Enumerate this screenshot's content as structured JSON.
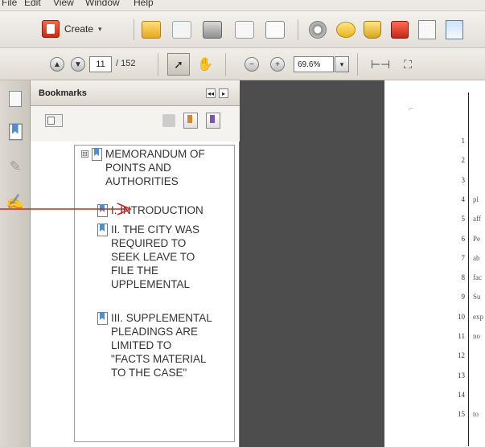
{
  "menu": [
    "File",
    "Edit",
    "View",
    "Window",
    "Help"
  ],
  "toolbar": {
    "create_label": "Create",
    "create_chevron": "▾"
  },
  "nav": {
    "page_number": "11",
    "page_total": "/ 152",
    "zoom_value": "69.6%",
    "zoom_chevron": "▾"
  },
  "bookmarks_panel": {
    "title": "Bookmarks",
    "collapse_btn": "◂◂",
    "options_btn": "▸",
    "expander_symbol": "⊟"
  },
  "bookmarks": [
    {
      "label": "MEMORANDUM OF\nPOINTS AND\nAUTHORITIES",
      "level": 0,
      "expandable": true
    },
    {
      "label": "I. INTRODUCTION",
      "level": 1,
      "expandable": false
    },
    {
      "label": "II. THE CITY WAS\nREQUIRED TO\nSEEK LEAVE TO\nFILE THE\nUPPLEMENTAL",
      "level": 1,
      "expandable": false
    },
    {
      "label": "III. SUPPLEMENTAL\nPLEADINGS ARE\nLIMITED TO\n\"FACTS MATERIAL\nTO THE CASE\"",
      "level": 1,
      "expandable": false
    }
  ],
  "document": {
    "line_numbers": [
      "1",
      "2",
      "3",
      "4",
      "5",
      "6",
      "7",
      "8",
      "9",
      "10",
      "11",
      "12",
      "13",
      "14",
      "15"
    ],
    "line_text": [
      "",
      "",
      "",
      "pl",
      "aff",
      "Pe",
      "ab",
      "fac",
      "Su",
      "exp",
      "no",
      "",
      "",
      "",
      "to"
    ]
  },
  "colors": {
    "annotation_arrow": "#e01e1e",
    "bookmark_ribbon": "#4f8fd1",
    "dark_background": "#4d4d4d"
  }
}
